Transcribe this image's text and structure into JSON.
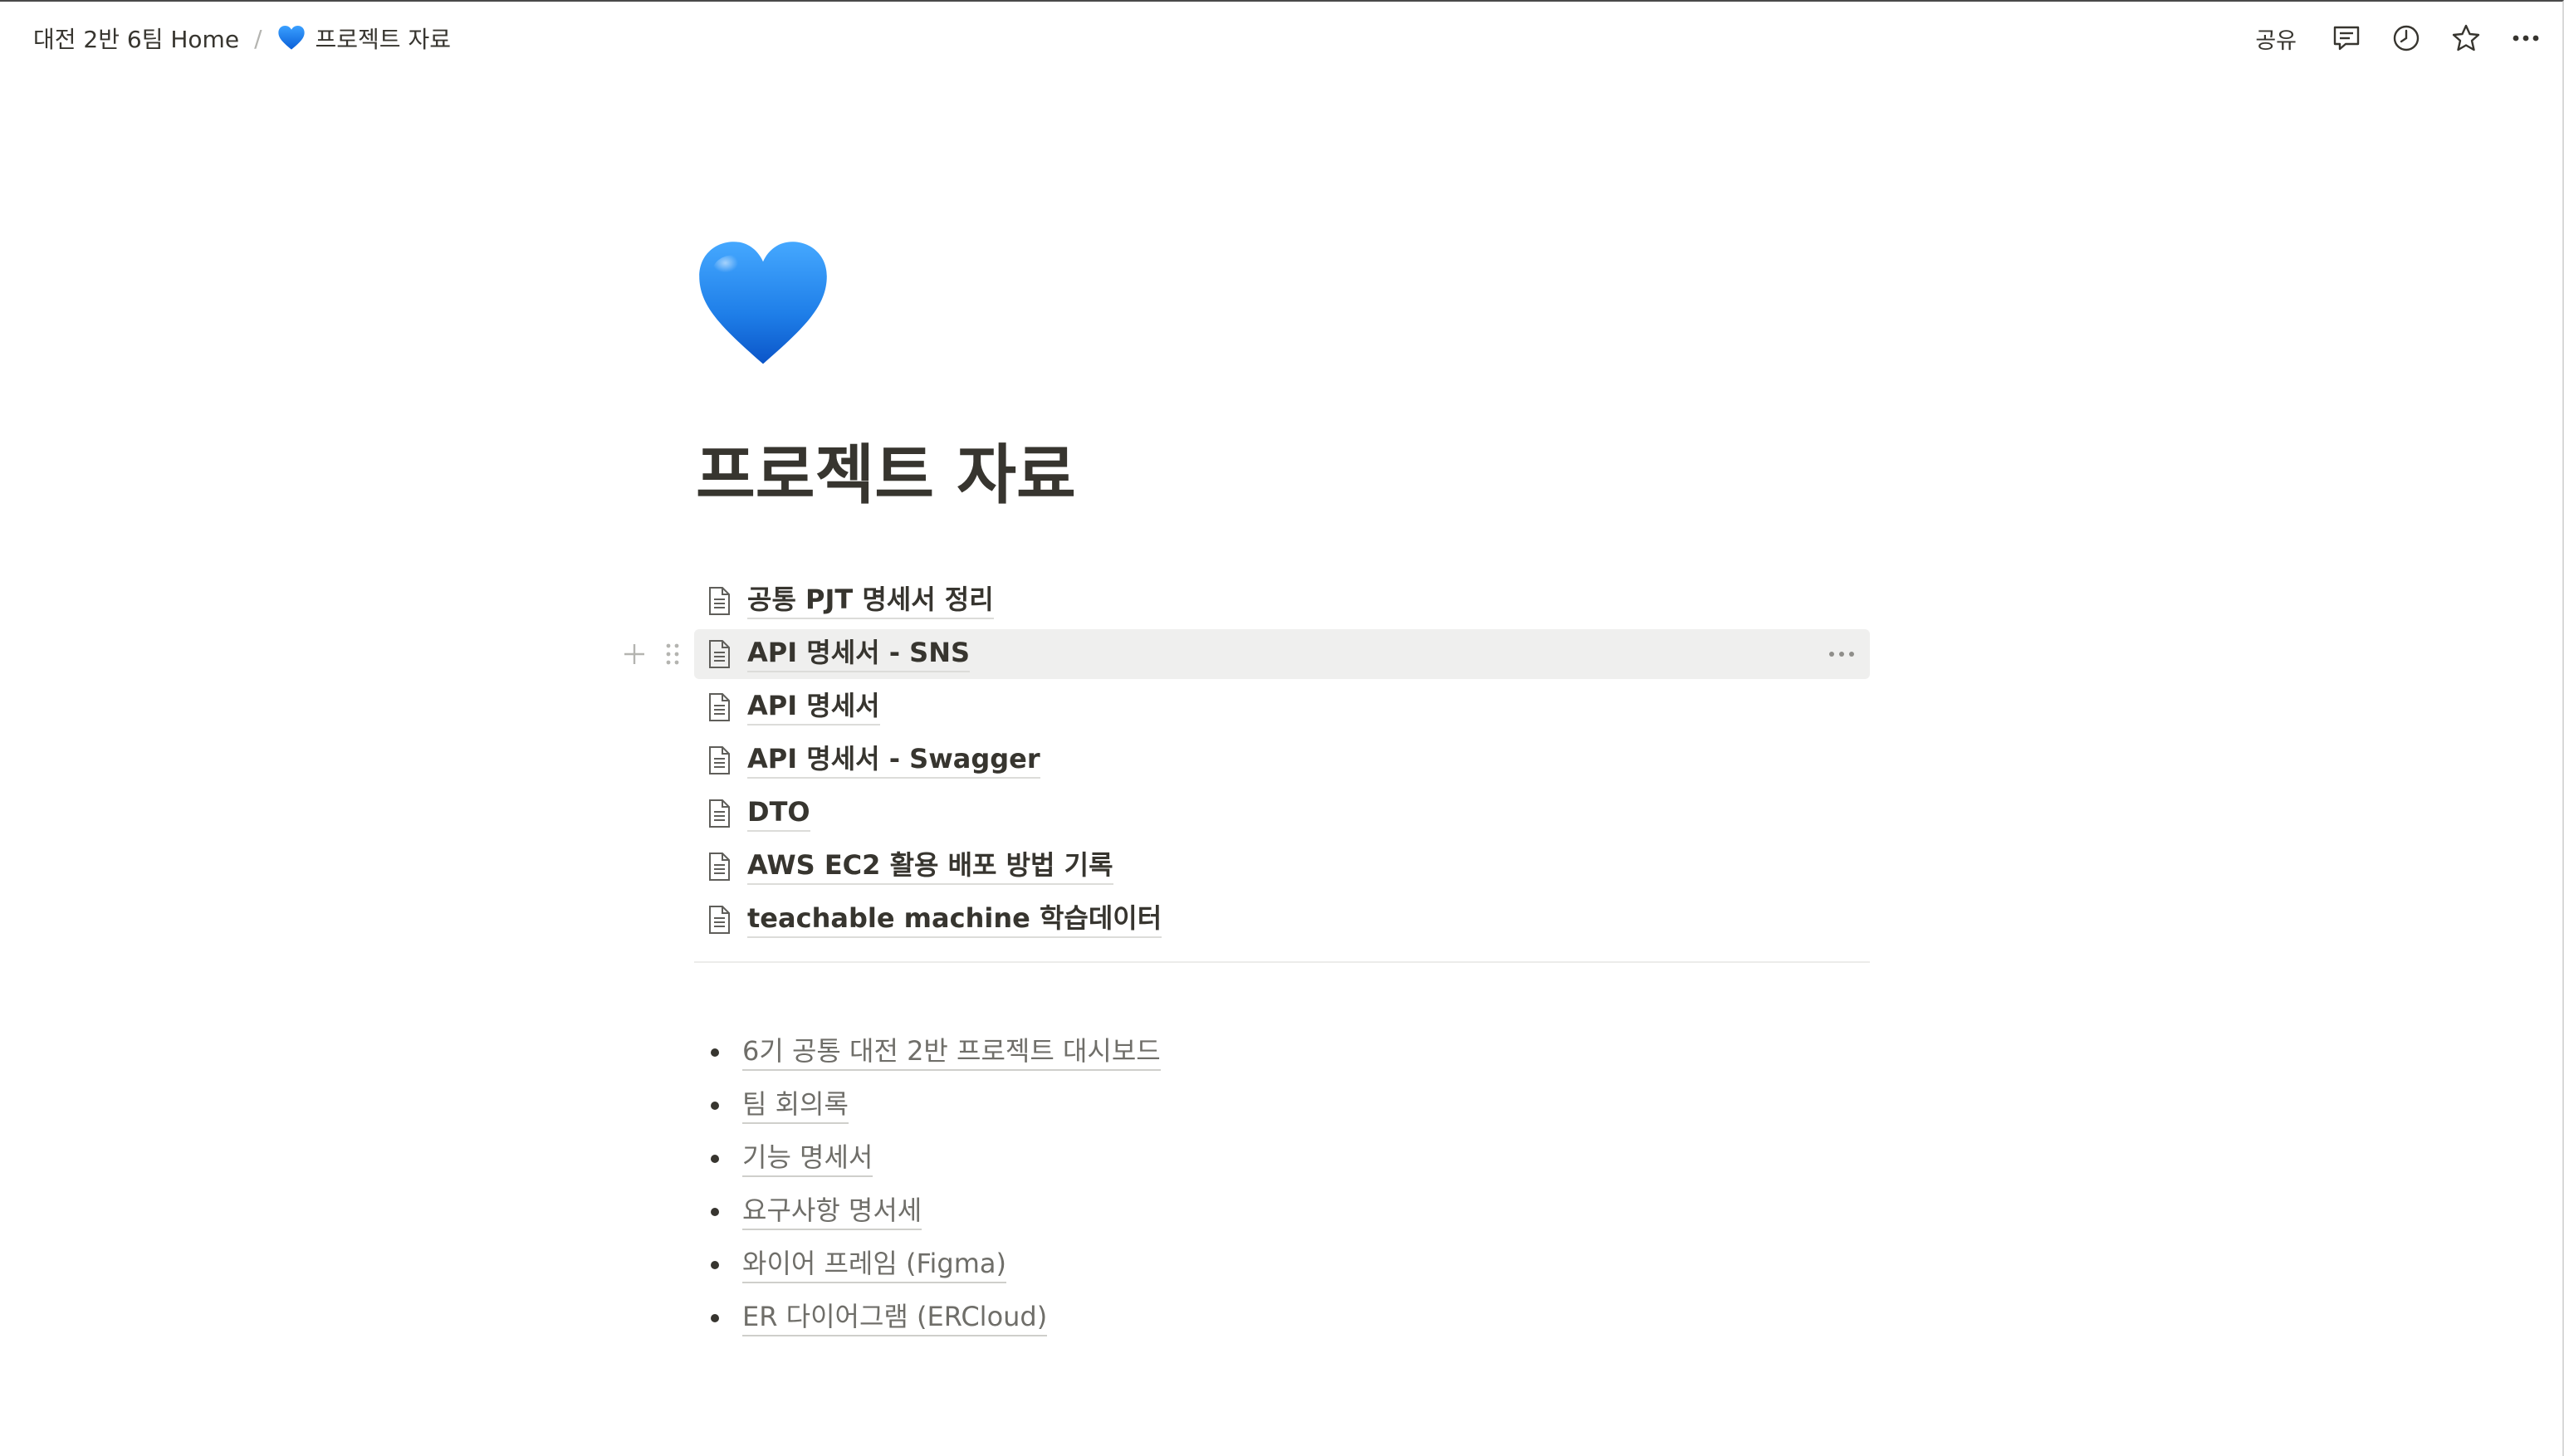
{
  "topbar": {
    "breadcrumb": [
      {
        "label": "대전 2반 6팀 Home"
      },
      {
        "label": "프로젝트 자료",
        "icon": "blue-heart-icon"
      }
    ],
    "separator": "/",
    "share_label": "공유",
    "icons": [
      "comment-icon",
      "history-clock-icon",
      "favorite-star-icon",
      "more-options-icon"
    ]
  },
  "page": {
    "icon": "blue-heart-icon",
    "title": "프로젝트 자료",
    "subpages": [
      {
        "label": "공통 PJT 명세서 정리"
      },
      {
        "label": "API 명세서 - SNS",
        "hovered": true
      },
      {
        "label": "API 명세서"
      },
      {
        "label": "API 명세서 - Swagger"
      },
      {
        "label": "DTO"
      },
      {
        "label": "AWS EC2 활용 배포 방법 기록"
      },
      {
        "label": "teachable machine 학습데이터"
      }
    ],
    "links": [
      {
        "label": "6기 공통 대전 2반 프로젝트 대시보드"
      },
      {
        "label": "팀 회의록"
      },
      {
        "label": "기능 명세서"
      },
      {
        "label": "요구사항 명서세"
      },
      {
        "label": "와이어 프레임 (Figma)"
      },
      {
        "label": "ER 다이어그램 (ERCloud)"
      }
    ]
  },
  "colors": {
    "text": "#37352f",
    "muted_link": "#6f6e69",
    "hover_bg": "#efefee",
    "heart": "#1e7ee8"
  }
}
